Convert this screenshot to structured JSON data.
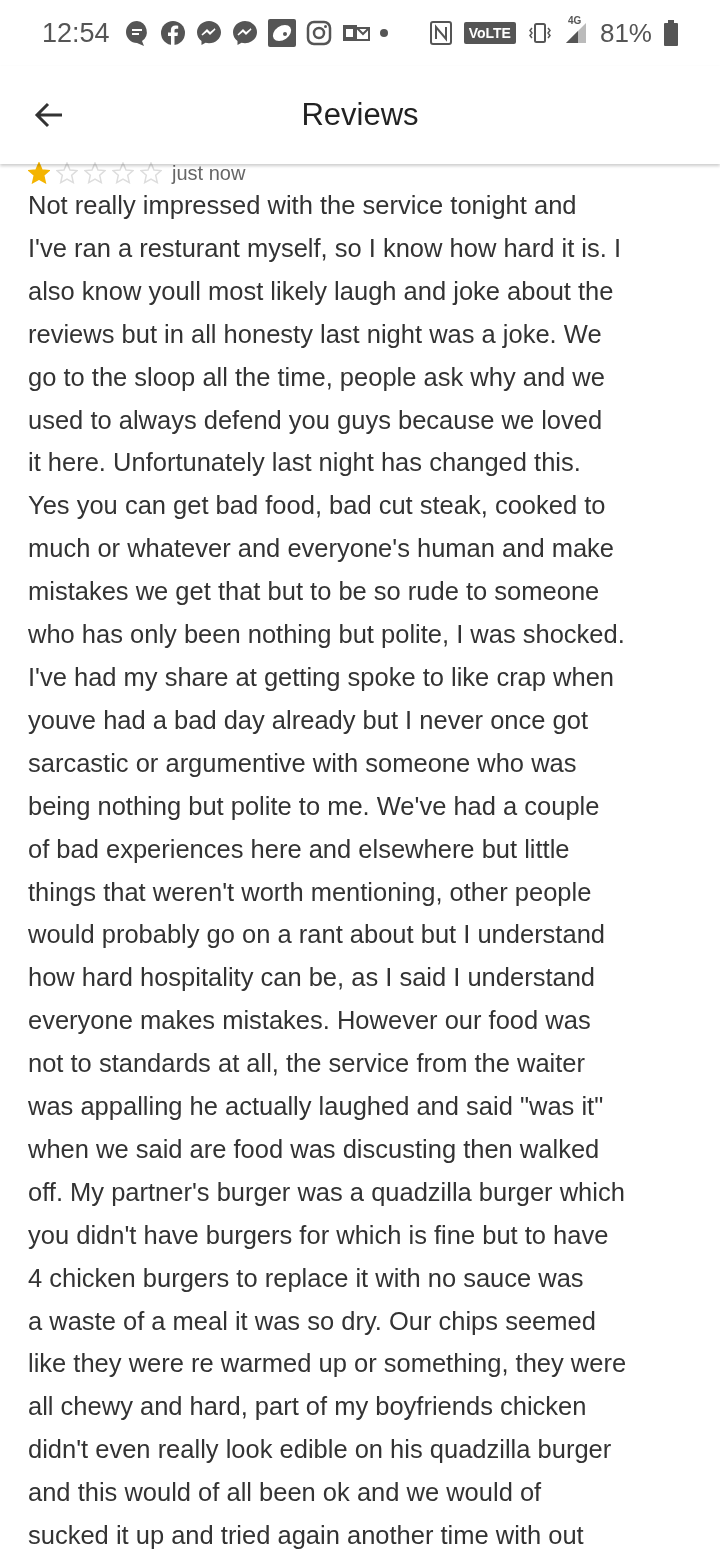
{
  "status_bar": {
    "time": "12:54",
    "network_badge": "VoLTE",
    "network_type": "4G",
    "battery": "81%"
  },
  "header": {
    "title": "Reviews"
  },
  "review": {
    "stars": 1,
    "time": "just now",
    "text": "Not really impressed with the service tonight and\nI've ran a resturant myself, so I know how hard it is. I\nalso know youll most likely laugh and joke about the\nreviews but in all honesty last night was a joke. We\ngo to the sloop all the time, people ask why and we\nused to always defend you guys because we loved\nit here. Unfortunately last night has changed this.\nYes you can get bad food, bad cut steak, cooked to\nmuch or whatever and everyone's human and make\nmistakes we get that but to be so rude to someone\nwho has only been nothing but polite, I was shocked.\nI've had my share at getting spoke to like crap when\nyouve had a bad day already but I never once got\nsarcastic or argumentive with someone who was\nbeing nothing but polite to me. We've had a couple\nof bad experiences here and elsewhere but little\nthings that weren't worth mentioning, other people\nwould probably go on a rant about but I understand\nhow hard hospitality can be, as I said I understand\neveryone makes mistakes. However our food was\nnot to standards at all, the service from the waiter\nwas appalling he actually laughed and said \"was it\"\nwhen we said are food was discusting then walked\noff. My partner's burger was a quadzilla burger which\nyou didn't have burgers for which is fine but to have\n4 chicken burgers to replace it with no sauce was\na waste of a meal it was so dry. Our chips seemed\nlike they were re warmed up or something, they were\nall chewy and hard, part of my boyfriends chicken\ndidn't even really look edible on his quadzilla burger\nand this would of all been ok and we would of\nsucked it up and tried again another time with out"
  }
}
